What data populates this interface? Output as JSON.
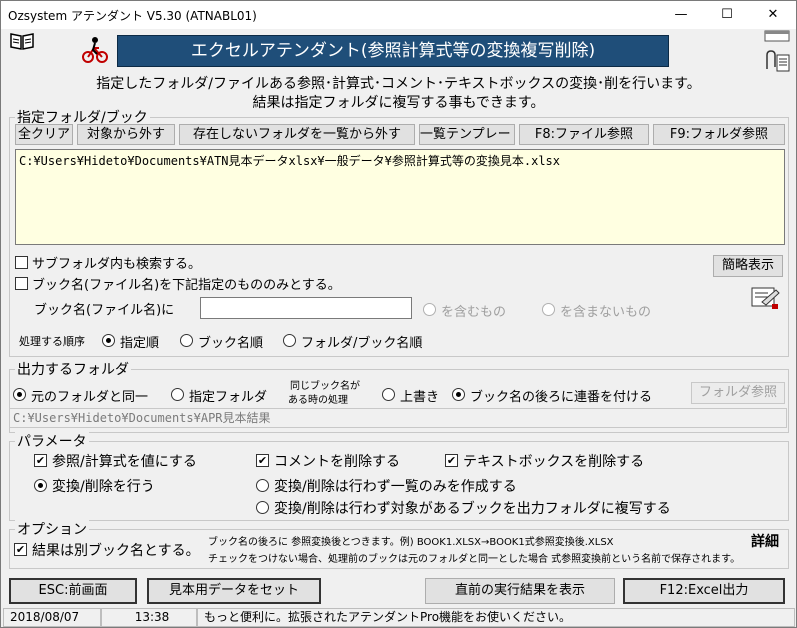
{
  "window": {
    "title": "Ozsystem アテンダント V5.30 (ATNABL01)",
    "minimize": "—",
    "maximize": "☐",
    "close": "✕"
  },
  "header": {
    "title": "エクセルアテンダント(参照計算式等の変換複写削除)",
    "description1": "指定したフォルダ/ファイルある参照･計算式･コメント･テキストボックスの変換･削を行います。",
    "description2": "結果は指定フォルダに複写する事もできます。"
  },
  "folder_section": {
    "legend": "指定フォルダ/ブック",
    "btn_clear_all": "全クリア",
    "btn_remove": "対象から外す",
    "btn_remove_missing": "存在しないフォルダを一覧から外す",
    "btn_template": "一覧テンプレート",
    "btn_f8": "F8:ファイル参照",
    "btn_f9": "F9:フォルダ参照",
    "list_text": "C:¥Users¥Hideto¥Documents¥ATN見本データxlsx¥一般データ¥参照計算式等の変換見本.xlsx",
    "chk_subfolder": "サブフォルダ内も検索する。",
    "chk_bookname_only": "ブック名(ファイル名)を下記指定のもののみとする。",
    "bookname_label": "ブック名(ファイル名)に",
    "bookname_value": "",
    "radio_contains": "を含むもの",
    "radio_not_contains": "を含まないもの",
    "btn_simple_view": "簡略表示",
    "order_label": "処理する順序",
    "order_options": [
      "指定順",
      "ブック名順",
      "フォルダ/ブック名順"
    ]
  },
  "output_section": {
    "legend": "出力するフォルダ",
    "radio_same": "元のフォルダと同一",
    "radio_specified": "指定フォルダ",
    "same_name_note1": "同じブック名が",
    "same_name_note2": "ある時の処理",
    "radio_overwrite": "上書き",
    "radio_sequence": "ブック名の後ろに連番を付ける",
    "btn_folder_ref": "フォルダ参照",
    "path": "C:¥Users¥Hideto¥Documents¥APR見本結果"
  },
  "params_section": {
    "legend": "パラメータ",
    "chk_ref_to_value": "参照/計算式を値にする",
    "chk_delete_comments": "コメントを削除する",
    "chk_delete_textbox": "テキストボックスを削除する",
    "radio_execute": "変換/削除を行う",
    "radio_list_only": "変換/削除は行わず一覧のみを作成する",
    "radio_copy_only": "変換/削除は行わず対象があるブックを出力フォルダに複写する"
  },
  "options_section": {
    "legend": "オプション",
    "chk_separate_book": "結果は別ブック名とする。",
    "note1": "ブック名の後ろに 参照変換後とつきます。例) BOOK1.XLSX→BOOK1式参照変換後.XLSX",
    "note2": "チェックをつけない場合、処理前のブックは元のフォルダと同一とした場合 式参照変換前という名前で保存されます。",
    "detail": "詳細"
  },
  "footer_buttons": {
    "esc": "ESC:前画面",
    "sample": "見本用データをセット",
    "last_result": "直前の実行結果を表示",
    "f12": "F12:Excel出力"
  },
  "status": {
    "date": "2018/08/07",
    "time": "13:38",
    "message": "もっと便利に。拡張されたアテンダントPro機能をお使いください。"
  },
  "colors": {
    "title_banner": "#1f4e79",
    "list_background": "#ffffe1"
  }
}
